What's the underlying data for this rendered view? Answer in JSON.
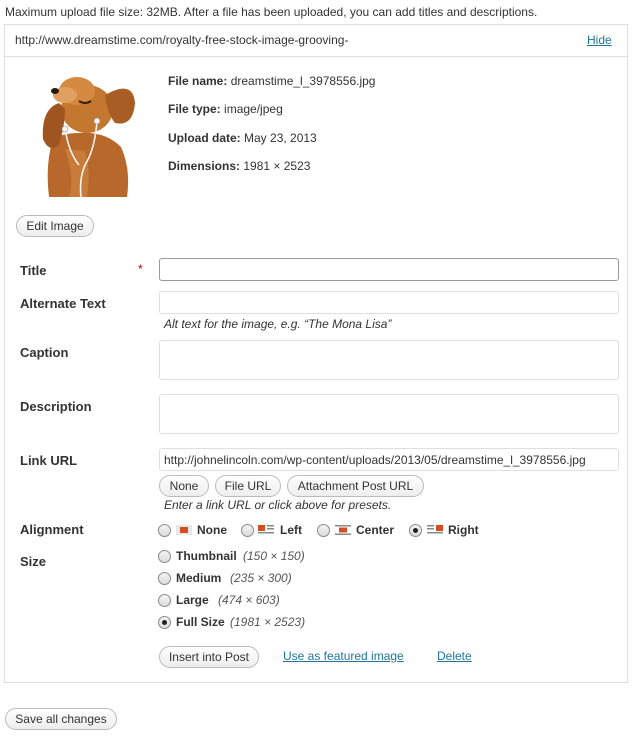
{
  "notice": "Maximum upload file size: 32MB. After a file has been uploaded, you can add titles and descriptions.",
  "item": {
    "url": "http://www.dreamstime.com/royalty-free-stock-image-grooving-",
    "hide_label": "Hide",
    "thumbnail": "puppy-with-earphones-photo",
    "file_name_label": "File name:",
    "file_name": "dreamstime_l_3978556.jpg",
    "file_type_label": "File type:",
    "file_type": "image/jpeg",
    "upload_date_label": "Upload date:",
    "upload_date": "May 23, 2013",
    "dimensions_label": "Dimensions:",
    "dimensions": "1981 × 2523",
    "edit_image_label": "Edit Image"
  },
  "form": {
    "title_label": "Title",
    "required_mark": "*",
    "title_value": "",
    "alt_label": "Alternate Text",
    "alt_value": "",
    "alt_hint": "Alt text for the image, e.g. “The Mona Lisa”",
    "caption_label": "Caption",
    "caption_value": "",
    "description_label": "Description",
    "description_value": "",
    "link_url_label": "Link URL",
    "link_url_value": "http://johnelincoln.com/wp-content/uploads/2013/05/dreamstime_l_3978556.jpg",
    "link_buttons": [
      "None",
      "File URL",
      "Attachment Post URL"
    ],
    "link_hint": "Enter a link URL or click above for presets.",
    "alignment_label": "Alignment",
    "alignment_options": [
      "None",
      "Left",
      "Center",
      "Right"
    ],
    "alignment_selected": "Right",
    "size_label": "Size",
    "size_options": [
      {
        "name": "Thumbnail",
        "dims": "(150 × 150)"
      },
      {
        "name": "Medium",
        "dims": "(235 × 300)"
      },
      {
        "name": "Large",
        "dims": "(474 × 603)"
      },
      {
        "name": "Full Size",
        "dims": "(1981 × 2523)"
      }
    ],
    "size_selected": "Full Size",
    "insert_label": "Insert into Post",
    "featured_label": "Use as featured image",
    "delete_label": "Delete"
  },
  "save_all_label": "Save all changes",
  "colors": {
    "link": "#21759b",
    "required": "#cc0000",
    "align_icon": "#d54e21"
  }
}
